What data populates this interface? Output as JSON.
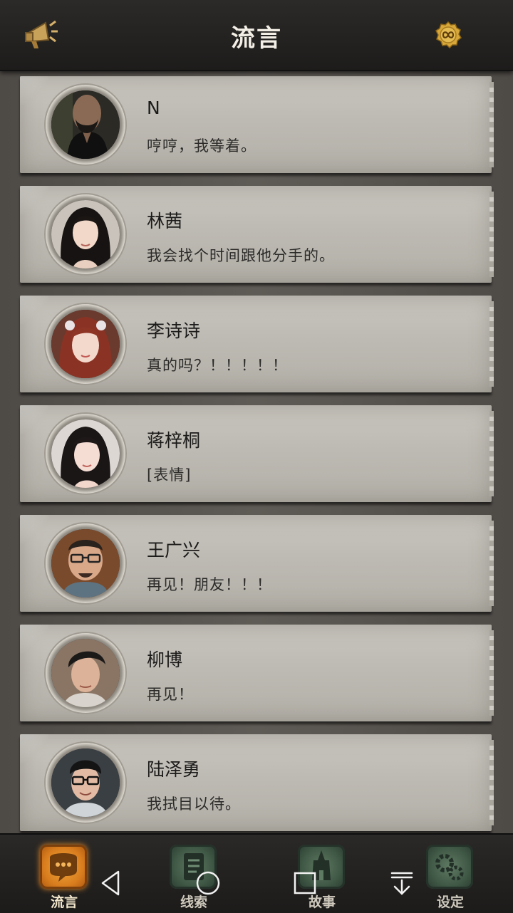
{
  "header": {
    "title": "流言",
    "left_icon": "megaphone-icon",
    "right_icon": "infinity-coin-icon"
  },
  "conversations": [
    {
      "name": "N",
      "message": "哼哼，我等着。"
    },
    {
      "name": "林茜",
      "message": "我会找个时间跟他分手的。"
    },
    {
      "name": "李诗诗",
      "message": "真的吗？！！！！！"
    },
    {
      "name": "蒋梓桐",
      "message": "[表情]"
    },
    {
      "name": "王广兴",
      "message": "再见！朋友！！！"
    },
    {
      "name": "柳博",
      "message": "再见！"
    },
    {
      "name": "陆泽勇",
      "message": "我拭目以待。"
    }
  ],
  "tabs": [
    {
      "label": "流言",
      "icon": "chat-bubble-icon",
      "active": true
    },
    {
      "label": "线索",
      "icon": "scroll-icon",
      "active": false
    },
    {
      "label": "故事",
      "icon": "tower-icon",
      "active": false
    },
    {
      "label": "设定",
      "icon": "gears-icon",
      "active": false
    }
  ],
  "colors": {
    "accent_active_tab": "#e08a2a",
    "inactive_tab": "#3f5745",
    "card_bg": "#c2bfb8",
    "header_bg": "#262422"
  }
}
